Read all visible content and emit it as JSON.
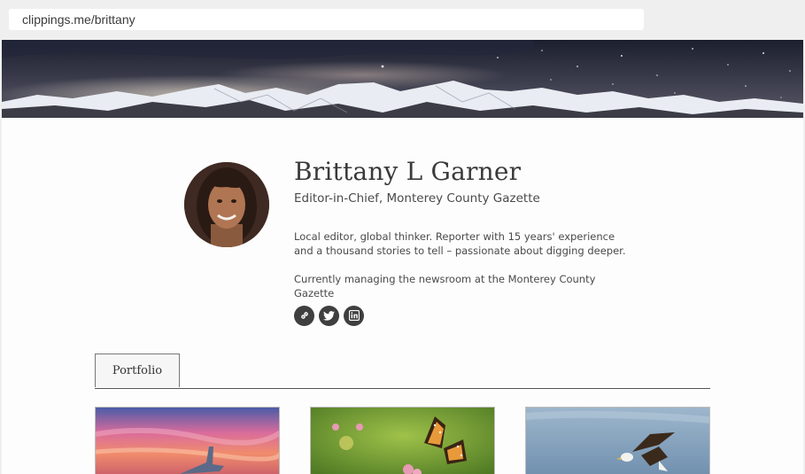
{
  "browser": {
    "url": "clippings.me/brittany"
  },
  "profile": {
    "name": "Brittany L Garner",
    "title": "Editor-in-Chief, Monterey County Gazette",
    "bio": [
      "Local editor, global thinker. Reporter with 15 years' experience and a thousand stories to tell – passionate about digging deeper.",
      "Currently managing the newsroom at the Monterey County Gazette"
    ],
    "social": [
      {
        "icon": "link-icon"
      },
      {
        "icon": "twitter-icon"
      },
      {
        "icon": "linkedin-icon"
      }
    ]
  },
  "tabs": [
    {
      "label": "Portfolio",
      "active": true
    }
  ],
  "portfolio": [
    {
      "image": "airplane-wing-sunset"
    },
    {
      "image": "monarch-butterfly"
    },
    {
      "image": "bald-eagle"
    }
  ],
  "colors": {
    "icon_bg": "#3f3f3f",
    "text": "#3a3a3a"
  }
}
